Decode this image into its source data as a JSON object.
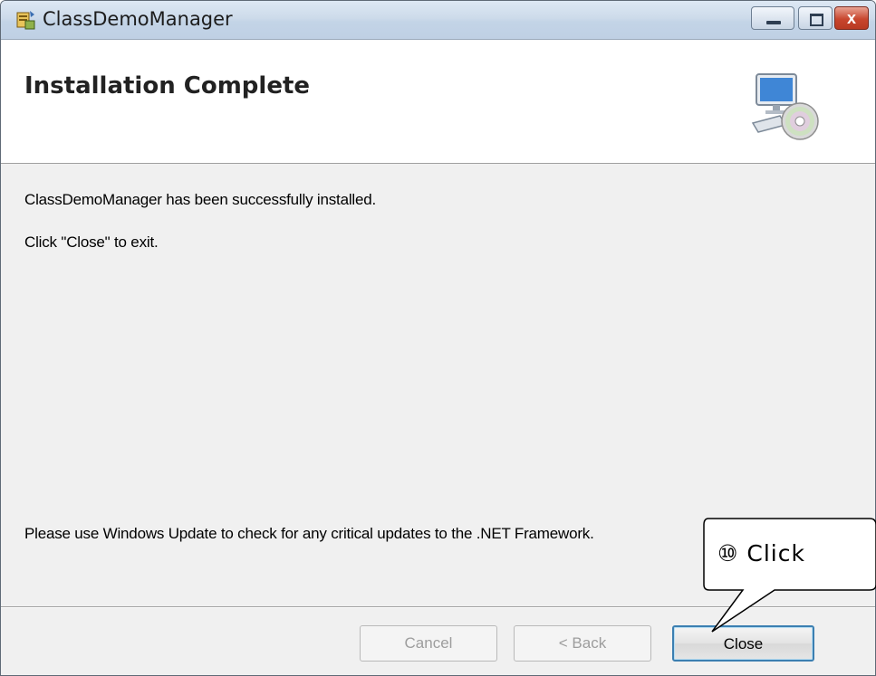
{
  "window": {
    "title": "ClassDemoManager",
    "buttons": {
      "minimize_icon": "minimize-icon",
      "maximize_icon": "maximize-icon",
      "close_icon": "close-icon",
      "close_glyph": "x"
    }
  },
  "banner": {
    "title": "Installation Complete",
    "icon": "computer-cd-icon"
  },
  "body": {
    "line1": "ClassDemoManager has been successfully installed.",
    "line2": "Click \"Close\" to exit.",
    "line3": "Please use Windows Update to check for any critical updates to the .NET Framework."
  },
  "footer": {
    "cancel_label": "Cancel",
    "back_label": "< Back",
    "close_label": "Close"
  },
  "callout": {
    "text": "⑩  Click"
  },
  "colors": {
    "titlebar": "#c3d4e7",
    "dialog_bg": "#f0f0f0",
    "banner_bg": "#ffffff",
    "close_caption": "#c8462e",
    "default_button_border": "#3c7fb1"
  }
}
